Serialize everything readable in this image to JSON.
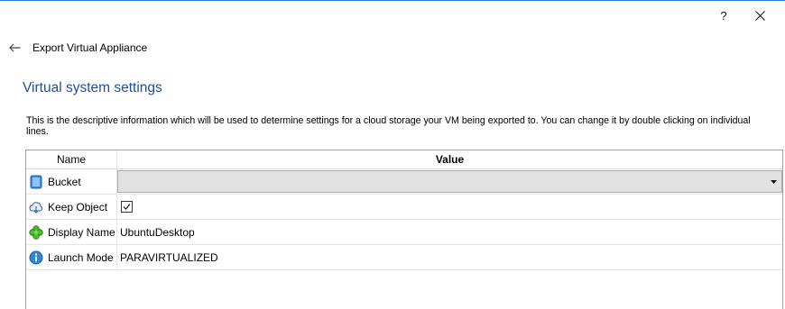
{
  "window": {
    "help_label": "?",
    "close_icon": "close-icon"
  },
  "header": {
    "back_icon": "arrow-left-icon",
    "title": "Export Virtual Appliance"
  },
  "section": {
    "title": "Virtual system settings",
    "description": "This is the descriptive information which will be used to determine settings for a cloud storage your VM being exported to. You can change it by double clicking on individual lines."
  },
  "grid": {
    "columns": [
      "Name",
      "Value"
    ],
    "rows": [
      {
        "name": "Bucket",
        "icon": "bucket-icon",
        "value": "",
        "type": "combo"
      },
      {
        "name": "Keep Object",
        "icon": "keep-object-icon",
        "value": "",
        "type": "checkbox",
        "checked": true
      },
      {
        "name": "Display Name",
        "icon": "display-name-icon",
        "value": "UbuntuDesktop",
        "type": "text"
      },
      {
        "name": "Launch Mode",
        "icon": "info-icon",
        "value": "PARAVIRTUALIZED",
        "type": "text"
      }
    ]
  },
  "colors": {
    "title_blue": "#1f4e99",
    "border_top": "#2b7bd4"
  }
}
